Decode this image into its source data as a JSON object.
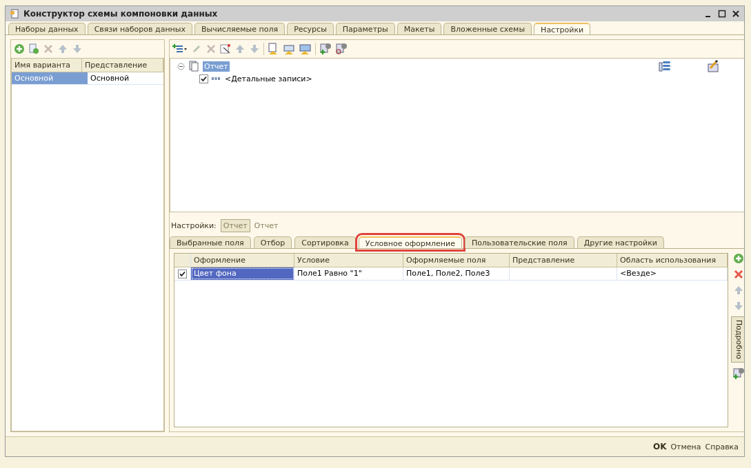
{
  "window": {
    "title": "Конструктор схемы компоновки данных"
  },
  "tabs": [
    {
      "label": "Наборы данных",
      "selected": false
    },
    {
      "label": "Связи наборов данных",
      "selected": false
    },
    {
      "label": "Вычисляемые поля",
      "selected": false
    },
    {
      "label": "Ресурсы",
      "selected": false
    },
    {
      "label": "Параметры",
      "selected": false
    },
    {
      "label": "Макеты",
      "selected": false
    },
    {
      "label": "Вложенные схемы",
      "selected": false
    },
    {
      "label": "Настройки",
      "selected": true
    }
  ],
  "variants": {
    "columns": [
      "Имя варианта",
      "Представление"
    ],
    "rows": [
      {
        "name": "Основной",
        "presentation": "Основной",
        "selected": true
      }
    ]
  },
  "tree": [
    {
      "label": "Отчет",
      "selected": true,
      "expanded": true,
      "children": [
        {
          "label": "<Детальные записи>",
          "checked": true
        }
      ]
    }
  ],
  "settings_bar": {
    "label": "Настройки:",
    "button": "Отчет",
    "value": "Отчет"
  },
  "subtabs": [
    {
      "label": "Выбранные поля",
      "selected": false,
      "highlighted": false
    },
    {
      "label": "Отбор",
      "selected": false,
      "highlighted": false
    },
    {
      "label": "Сортировка",
      "selected": false,
      "highlighted": false
    },
    {
      "label": "Условное оформление",
      "selected": true,
      "highlighted": true
    },
    {
      "label": "Пользовательские поля",
      "selected": false,
      "highlighted": false
    },
    {
      "label": "Другие настройки",
      "selected": false,
      "highlighted": false
    }
  ],
  "grid": {
    "columns": [
      "Оформление",
      "Условие",
      "Оформляемые поля",
      "Представление",
      "Область использования"
    ],
    "rows": [
      {
        "checked": true,
        "selected": true,
        "cells": [
          "Цвет фона",
          "Поле1 Равно \"1\"",
          "Поле1, Поле2, Поле3",
          "",
          "<Везде>"
        ]
      }
    ]
  },
  "side_button": "Подробно",
  "footer_buttons": [
    {
      "label": "OK",
      "kind": "default"
    },
    {
      "label": "Отмена",
      "kind": "normal"
    },
    {
      "label": "Справка",
      "kind": "normal"
    }
  ]
}
